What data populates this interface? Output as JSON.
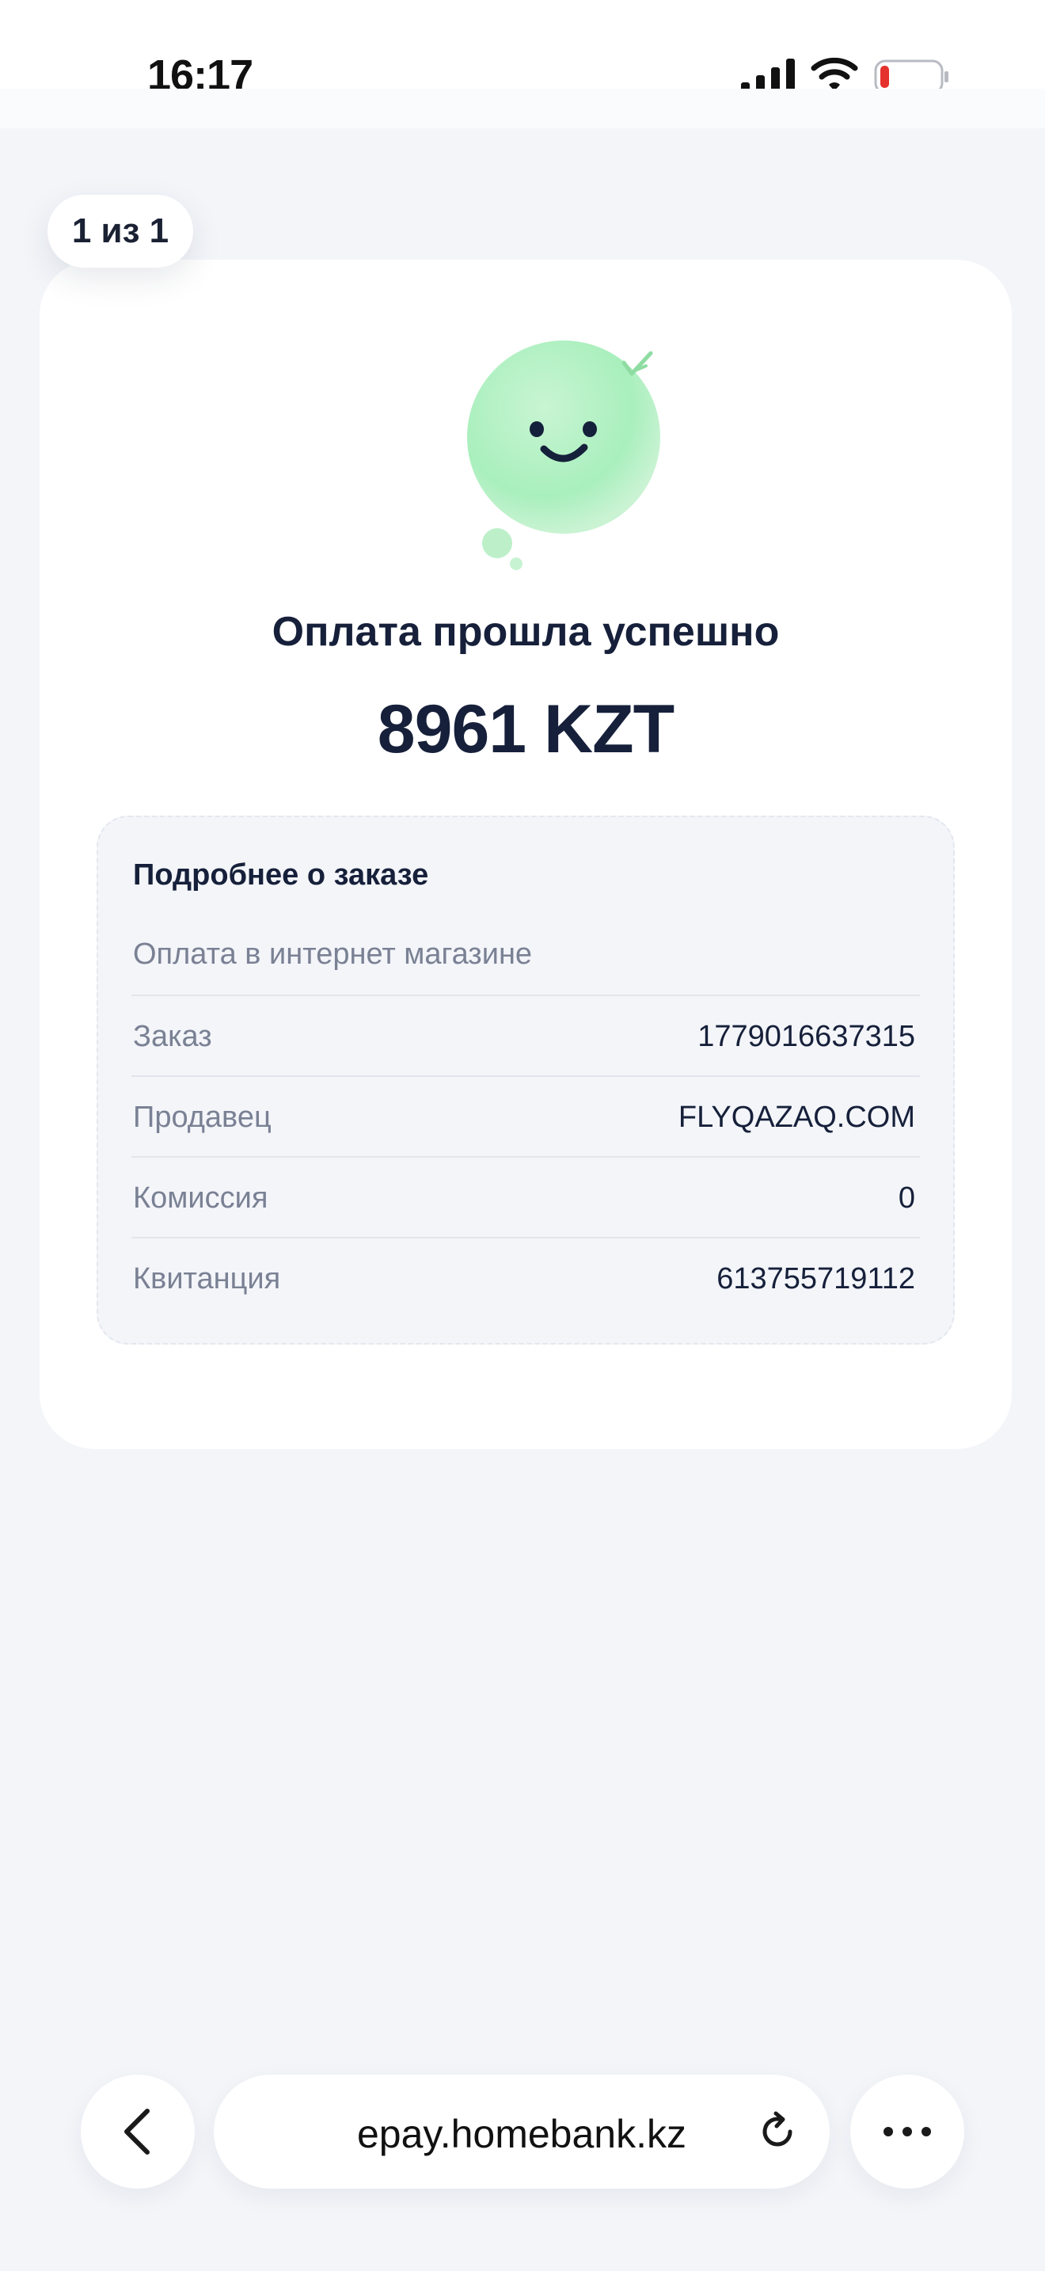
{
  "status_bar": {
    "time": "16:17",
    "icons": [
      "signal-icon",
      "wifi-icon",
      "battery-low-icon"
    ],
    "battery_color": "#e5322d"
  },
  "pager": {
    "label": "1 из 1"
  },
  "receipt": {
    "mascot_icon": "smiling-success-mascot-icon",
    "title": "Оплата прошла успешно",
    "amount": "8961 KZT",
    "details": {
      "heading": "Подробнее о заказе",
      "subtitle": "Оплата в интернет магазине",
      "rows": [
        {
          "label": "Заказ",
          "value": "1779016637315"
        },
        {
          "label": "Продавец",
          "value": "FLYQAZAQ.COM"
        },
        {
          "label": "Комиссия",
          "value": "0"
        },
        {
          "label": "Квитанция",
          "value": "613755719112"
        }
      ]
    }
  },
  "browser": {
    "url": "epay.homebank.kz",
    "icons": [
      "back-icon",
      "reload-icon",
      "more-icon"
    ]
  },
  "colors": {
    "background": "#f3f5f9",
    "card": "#ffffff",
    "text": "#16203a",
    "muted": "#7a8194",
    "mascot": "#b9f1c7"
  }
}
